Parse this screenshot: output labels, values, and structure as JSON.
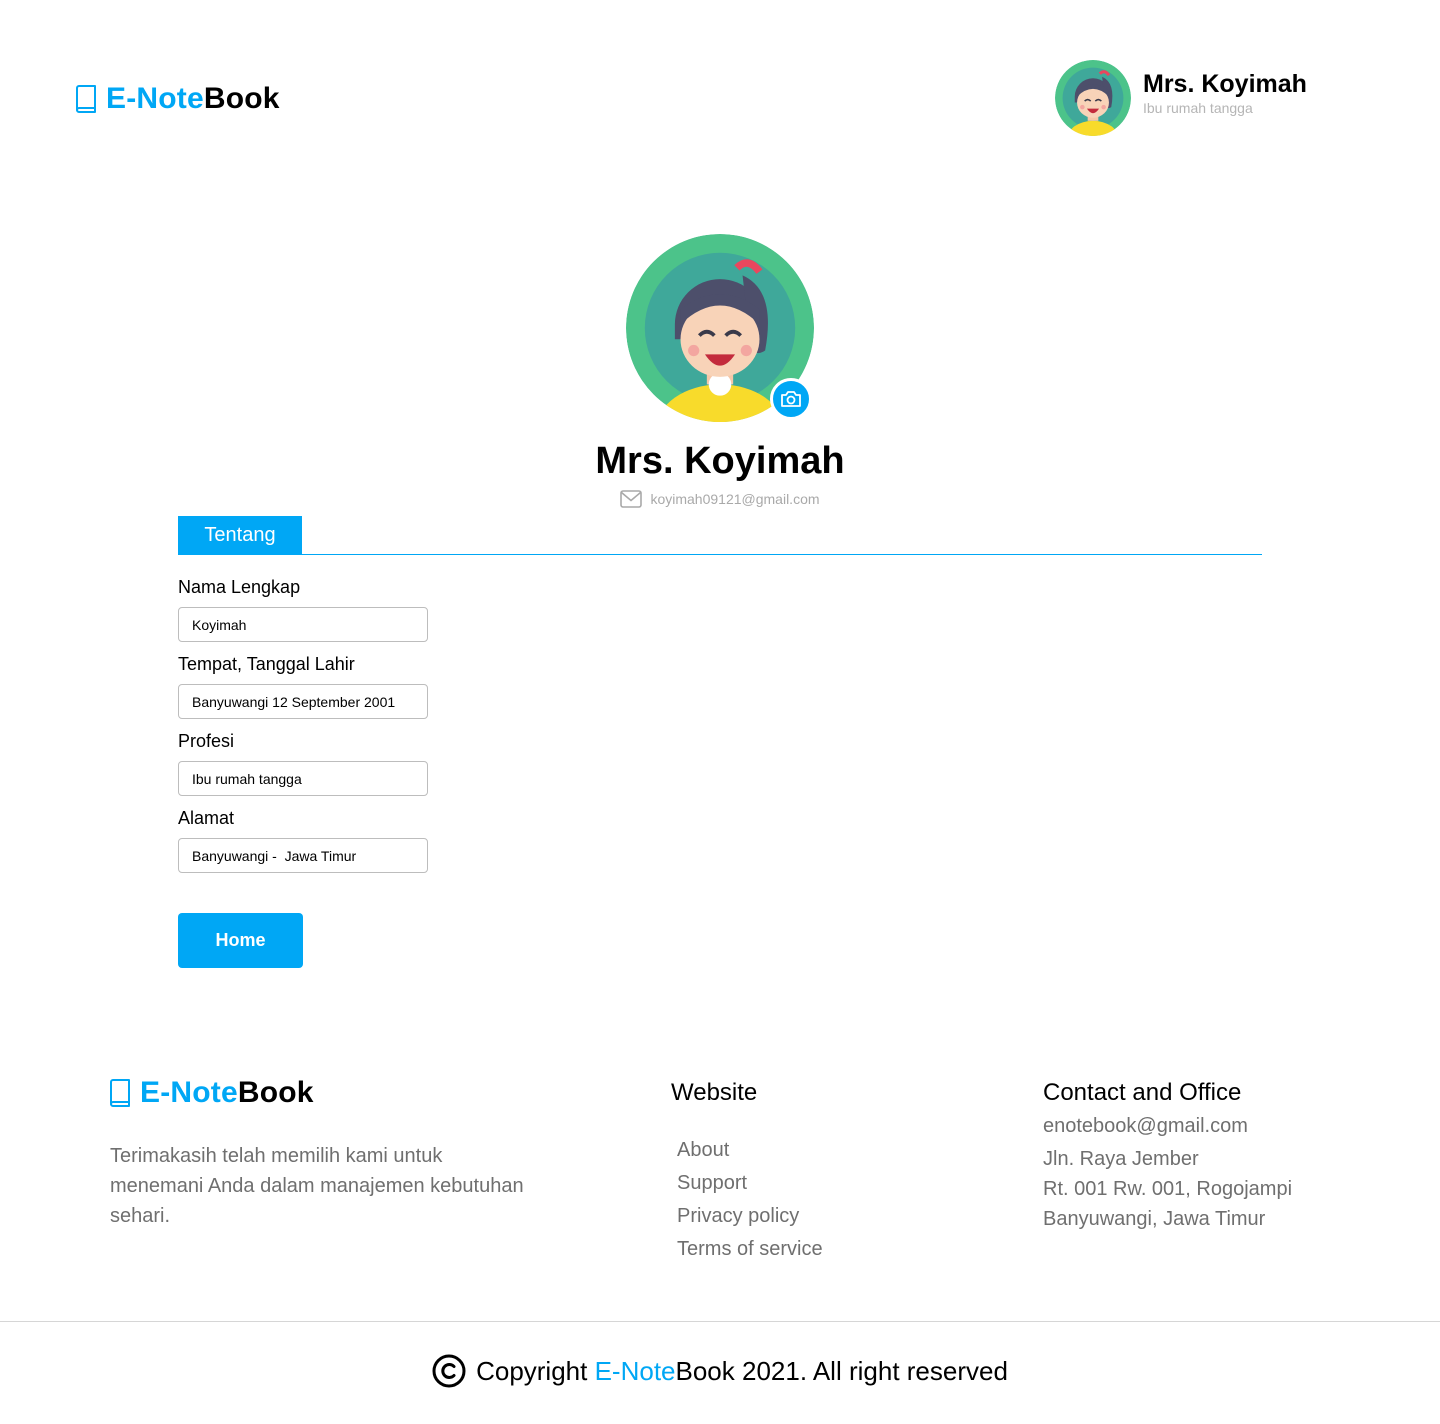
{
  "brand": {
    "part1": "E-Note",
    "part2": "Book"
  },
  "header_user": {
    "name": "Mrs. Koyimah",
    "role": "Ibu rumah tangga"
  },
  "profile": {
    "name": "Mrs. Koyimah",
    "email": "koyimah09121@gmail.com"
  },
  "tabs": [
    {
      "label": "Tentang",
      "active": true
    }
  ],
  "form": {
    "fields": [
      {
        "label": "Nama Lengkap",
        "value": "Koyimah"
      },
      {
        "label": "Tempat, Tanggal Lahir",
        "value": "Banyuwangi 12 September 2001"
      },
      {
        "label": "Profesi",
        "value": "Ibu rumah tangga"
      },
      {
        "label": "Alamat",
        "value": "Banyuwangi -  Jawa Timur"
      }
    ],
    "home_label": "Home"
  },
  "footer": {
    "description": "Terimakasih telah memilih kami untuk menemani Anda dalam manajemen kebutuhan sehari.",
    "website_heading": "Website",
    "links": [
      "About",
      "Support",
      "Privacy policy",
      "Terms of service"
    ],
    "contact_heading": "Contact and Office",
    "contact": [
      "enotebook@gmail.com",
      "Jln. Raya Jember",
      "Rt. 001 Rw. 001, Rogojampi",
      "Banyuwangi, Jawa Timur"
    ],
    "copyright": {
      "prefix": "Copyright ",
      "brand_accent": "E-Note",
      "brand_rest": "Book",
      "suffix": " 2021. All right reserved"
    }
  },
  "colors": {
    "accent": "#00A7F5",
    "muted": "#6F6F6F",
    "border": "#BDBDBD"
  },
  "icons": [
    "book-icon",
    "camera-icon",
    "mail-icon",
    "copyright-icon"
  ]
}
